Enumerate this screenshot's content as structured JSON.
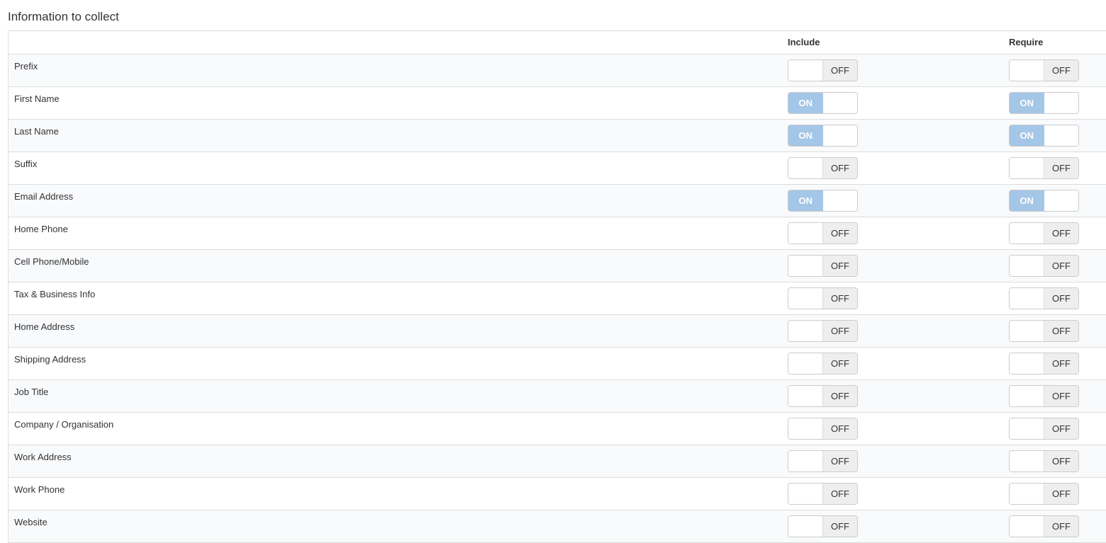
{
  "section": {
    "title": "Information to collect"
  },
  "table": {
    "headers": {
      "field": "",
      "include": "Include",
      "require": "Require"
    },
    "on_label": "ON",
    "off_label": "OFF",
    "rows": [
      {
        "label": "Prefix",
        "include": false,
        "require": false
      },
      {
        "label": "First Name",
        "include": true,
        "require": true
      },
      {
        "label": "Last Name",
        "include": true,
        "require": true
      },
      {
        "label": "Suffix",
        "include": false,
        "require": false
      },
      {
        "label": "Email Address",
        "include": true,
        "require": true
      },
      {
        "label": "Home Phone",
        "include": false,
        "require": false
      },
      {
        "label": "Cell Phone/Mobile",
        "include": false,
        "require": false
      },
      {
        "label": "Tax & Business Info",
        "include": false,
        "require": false
      },
      {
        "label": "Home Address",
        "include": false,
        "require": false
      },
      {
        "label": "Shipping Address",
        "include": false,
        "require": false
      },
      {
        "label": "Job Title",
        "include": false,
        "require": false
      },
      {
        "label": "Company / Organisation",
        "include": false,
        "require": false
      },
      {
        "label": "Work Address",
        "include": false,
        "require": false
      },
      {
        "label": "Work Phone",
        "include": false,
        "require": false
      },
      {
        "label": "Website",
        "include": false,
        "require": false
      }
    ]
  },
  "colors": {
    "toggle_on": "#a4c6e7",
    "toggle_off": "#eeeeee",
    "row_stripe": "#f9fafc",
    "border": "#dddddd"
  }
}
